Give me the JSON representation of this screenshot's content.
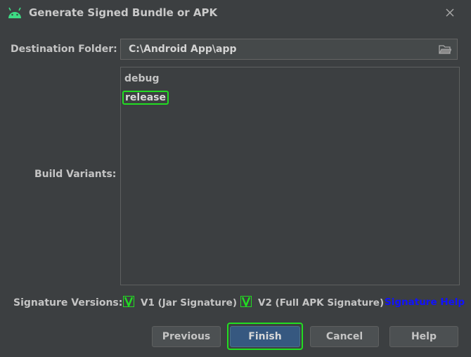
{
  "window": {
    "title": "Generate Signed Bundle or APK",
    "app_icon": "android-icon",
    "close_icon": "close-icon"
  },
  "destination": {
    "label": "Destination Folder:",
    "value": "C:\\Android App\\app",
    "browse_icon": "folder-icon"
  },
  "build_variants": {
    "label": "Build Variants:",
    "items": [
      {
        "label": "debug",
        "selected": false
      },
      {
        "label": "release",
        "selected": true
      }
    ]
  },
  "signature": {
    "label": "Signature Versions:",
    "v1_label": "V1 (Jar Signature)",
    "v1_checked": true,
    "v2_label": "V2 (Full APK Signature)",
    "v2_checked": true,
    "help_link": "Signature Help",
    "help_color": "#1111ff"
  },
  "buttons": {
    "previous": "Previous",
    "finish": "Finish",
    "cancel": "Cancel",
    "help": "Help"
  },
  "colors": {
    "background": "#3c3f41",
    "default_button": "#365880",
    "highlight": "#22dd22"
  }
}
